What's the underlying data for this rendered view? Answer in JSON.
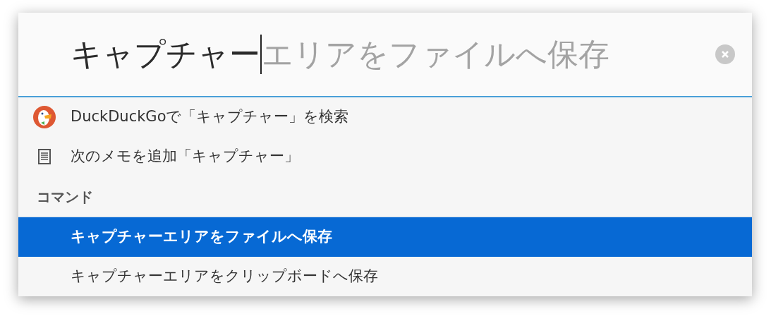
{
  "search": {
    "value": "キャプチャー",
    "completion": "エリアをファイルへ保存"
  },
  "results": [
    {
      "kind": "web",
      "label": "DuckDuckGoで「キャプチャー」を検索"
    },
    {
      "kind": "note",
      "label": "次のメモを追加「キャプチャー」"
    }
  ],
  "section": {
    "title": "コマンド"
  },
  "commands": [
    {
      "label": "キャプチャーエリアをファイルへ保存",
      "selected": true
    },
    {
      "label": "キャプチャーエリアをクリップボードへ保存",
      "selected": false
    }
  ]
}
